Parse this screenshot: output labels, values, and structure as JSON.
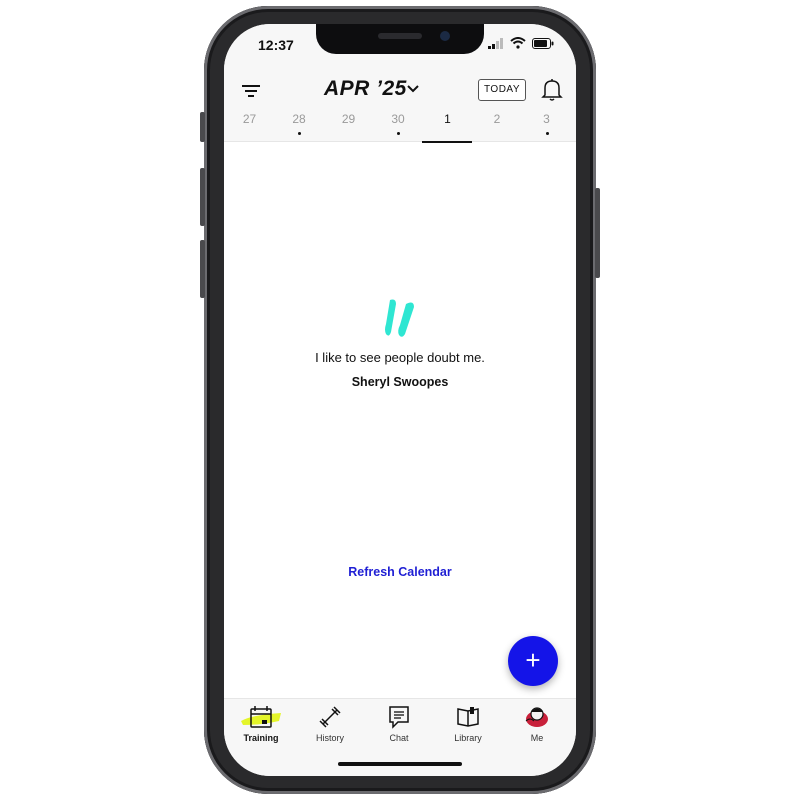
{
  "status_bar": {
    "time": "12:37"
  },
  "header": {
    "month_label": "APR ’25",
    "today_label": "TODAY",
    "days": [
      {
        "label": "27",
        "has_event": false,
        "active": false
      },
      {
        "label": "28",
        "has_event": true,
        "active": false
      },
      {
        "label": "29",
        "has_event": false,
        "active": false
      },
      {
        "label": "30",
        "has_event": true,
        "active": false
      },
      {
        "label": "1",
        "has_event": false,
        "active": true
      },
      {
        "label": "2",
        "has_event": false,
        "active": false
      },
      {
        "label": "3",
        "has_event": true,
        "active": false
      }
    ]
  },
  "quote": {
    "text": "I like to see people doubt me.",
    "author": "Sheryl Swoopes"
  },
  "refresh_label": "Refresh Calendar",
  "fab_label": "+",
  "tabs": [
    {
      "label": "Training",
      "icon": "calendar-icon",
      "active": true
    },
    {
      "label": "History",
      "icon": "dumbbell-icon",
      "active": false
    },
    {
      "label": "Chat",
      "icon": "chat-icon",
      "active": false
    },
    {
      "label": "Library",
      "icon": "book-icon",
      "active": false
    },
    {
      "label": "Me",
      "icon": "avatar",
      "active": false
    }
  ],
  "colors": {
    "accent": "#1414e8",
    "quote_mark": "#2fe6d2",
    "highlight": "#e4f52a",
    "link": "#1f1fd4"
  }
}
